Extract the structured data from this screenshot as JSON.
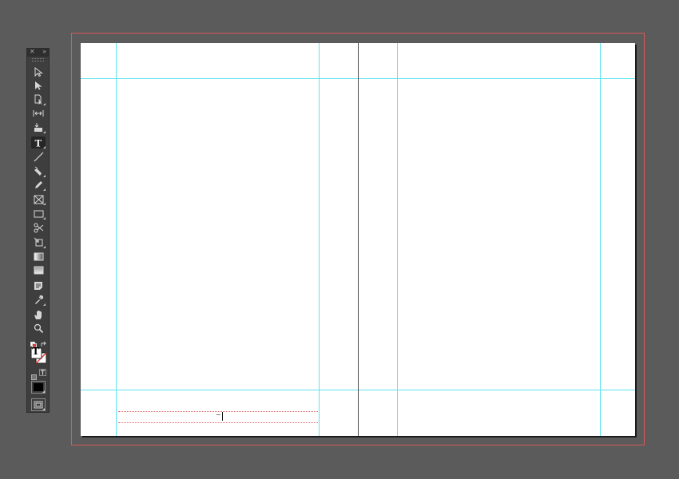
{
  "panel": {
    "close_glyph": "✕",
    "collapse_glyph": "»"
  },
  "tools": [
    {
      "name": "selection-tool-icon"
    },
    {
      "name": "direct-selection-tool-icon"
    },
    {
      "name": "page-tool-icon"
    },
    {
      "name": "gap-tool-icon"
    },
    {
      "name": "content-collector-tool-icon"
    },
    {
      "name": "type-tool-icon",
      "active": true
    },
    {
      "name": "line-tool-icon"
    },
    {
      "name": "pen-tool-icon"
    },
    {
      "name": "pencil-tool-icon"
    },
    {
      "name": "rectangle-frame-tool-icon"
    },
    {
      "name": "rectangle-tool-icon"
    },
    {
      "name": "scissors-tool-icon"
    },
    {
      "name": "free-transform-tool-icon"
    },
    {
      "name": "gradient-swatch-tool-icon"
    },
    {
      "name": "gradient-feather-tool-icon"
    },
    {
      "name": "note-tool-icon"
    },
    {
      "name": "eyedropper-tool-icon"
    },
    {
      "name": "hand-tool-icon"
    },
    {
      "name": "zoom-tool-icon"
    }
  ],
  "fill_stroke": {
    "formatting_glyph": "T"
  },
  "colors": {
    "guide": "#5ee4ee",
    "bleed": "#d75a5a",
    "page": "#ffffff",
    "pasteboard": "#5b5b5b"
  },
  "text_frame": {
    "marker": "~"
  }
}
